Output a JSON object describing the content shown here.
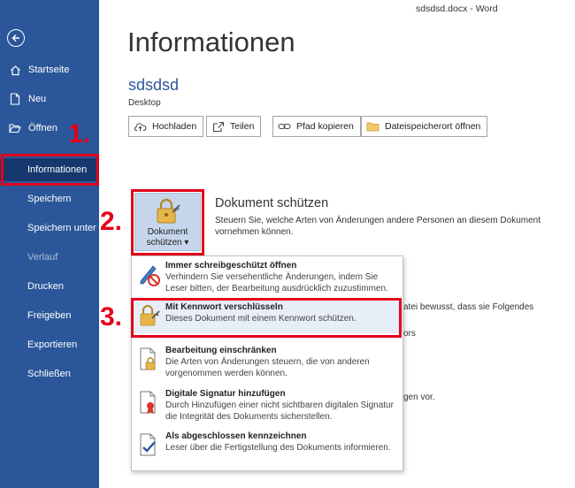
{
  "window": {
    "title": "sdsdsd.docx  -  Word"
  },
  "sidebar": {
    "back_icon": "back-arrow-icon",
    "items": [
      {
        "label": "Startseite",
        "icon": "home-icon"
      },
      {
        "label": "Neu",
        "icon": "new-doc-icon"
      },
      {
        "label": "Öffnen",
        "icon": "folder-open-icon"
      },
      {
        "label": "Informationen"
      },
      {
        "label": "Speichern"
      },
      {
        "label": "Speichern unter"
      },
      {
        "label": "Verlauf"
      },
      {
        "label": "Drucken"
      },
      {
        "label": "Freigeben"
      },
      {
        "label": "Exportieren"
      },
      {
        "label": "Schließen"
      }
    ]
  },
  "annotations": {
    "step1": "1.",
    "step2": "2.",
    "step3": "3.",
    "color": "#e3001b"
  },
  "main": {
    "heading": "Informationen",
    "doc_name": "sdsdsd",
    "doc_location": "Desktop",
    "toolbar": {
      "upload": "Hochladen",
      "share": "Teilen",
      "copy_path": "Pfad kopieren",
      "open_location": "Dateispeicherort öffnen"
    },
    "protect": {
      "button_line1": "Dokument",
      "button_line2": "schützen ▾",
      "title": "Dokument schützen",
      "description": "Steuern Sie, welche Arten von Änderungen andere Personen an diesem Dokument vornehmen können."
    },
    "background_fragments": {
      "f1": "atei bewusst, dass sie Folgendes",
      "f2": "ors",
      "f3": "gen vor."
    }
  },
  "menu": {
    "items": [
      {
        "title": "Immer schreibgeschützt öffnen",
        "desc": "Verhindern Sie versehentliche Änderungen, indem Sie Leser bitten, der Bearbeitung ausdrücklich zuzustimmen."
      },
      {
        "title": "Mit Kennwort verschlüsseln",
        "desc": "Dieses Dokument mit einem Kennwort schützen."
      },
      {
        "title": "Bearbeitung einschränken",
        "desc": "Die Arten von Änderungen steuern, die von anderen vorgenommen werden können."
      },
      {
        "title": "Digitale Signatur hinzufügen",
        "desc": "Durch Hinzufügen einer nicht sichtbaren digitalen Signatur die Integrität des Dokuments sicherstellen."
      },
      {
        "title": "Als abgeschlossen kennzeichnen",
        "desc": "Leser über die Fertigstellung des Dokuments informieren."
      }
    ]
  },
  "colors": {
    "sidebar": "#2b579a",
    "sidebar_active": "#17386e",
    "accent": "#2b579a",
    "highlight": "#e3001b"
  }
}
